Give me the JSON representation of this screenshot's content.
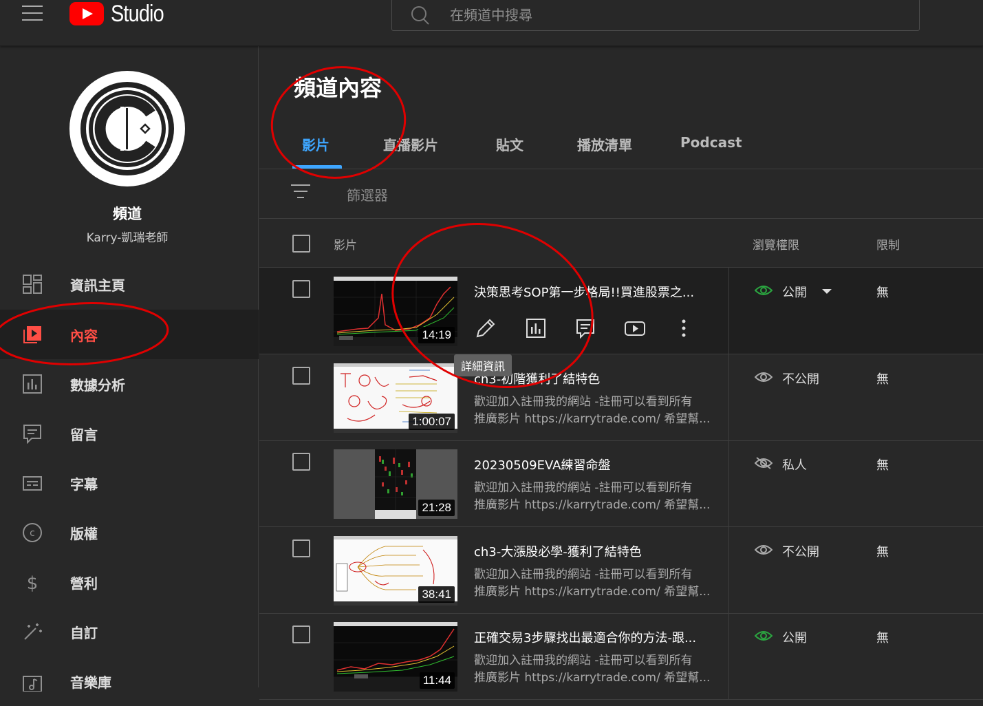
{
  "header": {
    "logo_text": "Studio",
    "search_placeholder": "在頻道中搜尋"
  },
  "sidebar": {
    "channel_label": "頻道",
    "channel_name": "Karry-凱瑞老師",
    "items": [
      {
        "label": "資訊主頁",
        "icon": "dashboard-icon"
      },
      {
        "label": "內容",
        "icon": "content-icon",
        "active": true
      },
      {
        "label": "數據分析",
        "icon": "analytics-icon"
      },
      {
        "label": "留言",
        "icon": "comments-icon"
      },
      {
        "label": "字幕",
        "icon": "subtitles-icon"
      },
      {
        "label": "版權",
        "icon": "copyright-icon"
      },
      {
        "label": "營利",
        "icon": "monetization-icon"
      },
      {
        "label": "自訂",
        "icon": "customize-icon"
      },
      {
        "label": "音樂庫",
        "icon": "audio-library-icon"
      }
    ]
  },
  "main": {
    "title": "頻道內容",
    "tabs": [
      {
        "label": "影片",
        "active": true
      },
      {
        "label": "直播影片"
      },
      {
        "label": "貼文"
      },
      {
        "label": "播放清單"
      },
      {
        "label": "Podcast"
      }
    ],
    "filter_label": "篩選器",
    "columns": {
      "video": "影片",
      "visibility": "瀏覽權限",
      "restrictions": "限制"
    },
    "tooltip": "詳細資訊",
    "videos": [
      {
        "title": "決策思考SOP第一步格局!!買進股票之...",
        "desc1": "",
        "desc2": "",
        "duration": "14:19",
        "visibility": "公開",
        "visibility_type": "public",
        "restriction": "無"
      },
      {
        "title": "ch3-初階獲利了結特色",
        "desc1": "歡迎加入註冊我的網站 -註冊可以看到所有",
        "desc2": "推廣影片 https://karrytrade.com/ 希望幫...",
        "duration": "1:00:07",
        "visibility": "不公開",
        "visibility_type": "unlisted",
        "restriction": "無"
      },
      {
        "title": "20230509EVA練習命盤",
        "desc1": "歡迎加入註冊我的網站 -註冊可以看到所有",
        "desc2": "推廣影片 https://karrytrade.com/ 希望幫...",
        "duration": "21:28",
        "visibility": "私人",
        "visibility_type": "private",
        "restriction": "無"
      },
      {
        "title": "ch3-大漲股必學-獲利了結特色",
        "desc1": "歡迎加入註冊我的網站 -註冊可以看到所有",
        "desc2": "推廣影片 https://karrytrade.com/ 希望幫...",
        "duration": "38:41",
        "visibility": "不公開",
        "visibility_type": "unlisted",
        "restriction": "無"
      },
      {
        "title": "正確交易3步驟找出最適合你的方法-跟...",
        "desc1": "歡迎加入註冊我的網站 -註冊可以看到所有",
        "desc2": "推廣影片 https://karrytrade.com/ 希望幫...",
        "duration": "11:44",
        "visibility": "公開",
        "visibility_type": "public",
        "restriction": "無"
      }
    ]
  },
  "colors": {
    "accent_blue": "#3ea6ff",
    "active_red": "#ff4e45",
    "public_green": "#2ba640",
    "annotation_red": "#e00000"
  }
}
